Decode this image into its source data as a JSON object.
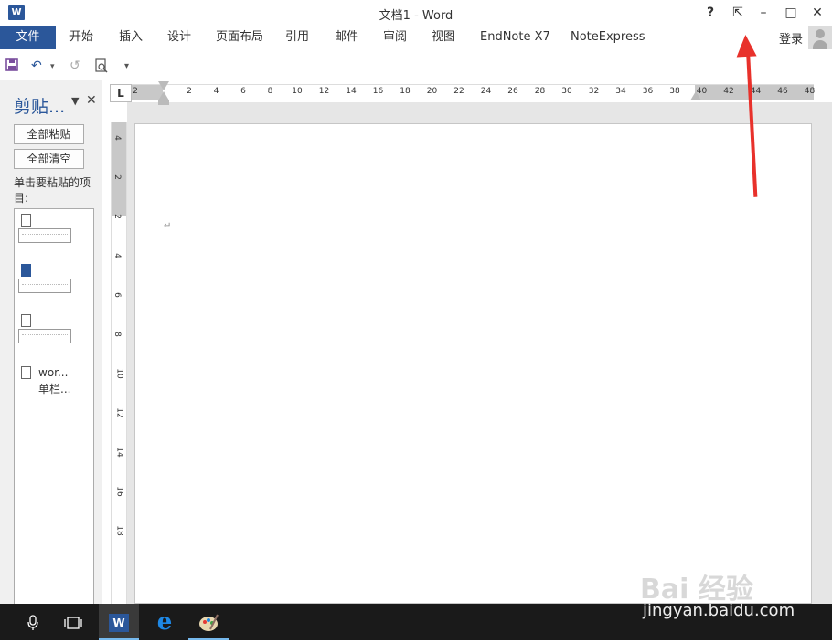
{
  "window": {
    "title": "文档1 - Word",
    "icon_letter": "W",
    "help": "?",
    "ribbon_display": "⇱",
    "minimize": "–",
    "maximize": "□",
    "close": "✕"
  },
  "ribbon": {
    "tabs": [
      "文件",
      "开始",
      "插入",
      "设计",
      "页面布局",
      "引用",
      "邮件",
      "审阅",
      "视图",
      "EndNote X7",
      "NoteExpress"
    ],
    "login": "登录"
  },
  "qat": {
    "save": "💾",
    "undo": "↶",
    "redo": "↺",
    "preview": "🔍",
    "customize": "▾"
  },
  "clipboard": {
    "title": "剪贴...",
    "paste_all": "全部粘贴",
    "clear_all": "全部清空",
    "hint": "单击要粘贴的项目:",
    "item4_line1": "wor...",
    "item4_line2": "单栏..."
  },
  "ruler": {
    "tab_selector": "L",
    "h_labels": [
      "2",
      "2",
      "4",
      "6",
      "8",
      "10",
      "12",
      "14",
      "16",
      "18",
      "20",
      "22",
      "24",
      "26",
      "28",
      "30",
      "32",
      "34",
      "36",
      "38",
      "40",
      "42",
      "44",
      "46",
      "48"
    ],
    "v_labels": [
      "4",
      "2",
      "2",
      "4",
      "6",
      "8",
      "10",
      "12",
      "14",
      "16",
      "18"
    ]
  },
  "document": {
    "paragraph_mark": "↵"
  },
  "taskbar": {
    "mic": "🎤",
    "taskview": "❐",
    "word": "W",
    "edge": "e",
    "paint": "🎨"
  },
  "watermark": {
    "brand": "Bai 经验",
    "url": "jingyan.baidu.com"
  }
}
